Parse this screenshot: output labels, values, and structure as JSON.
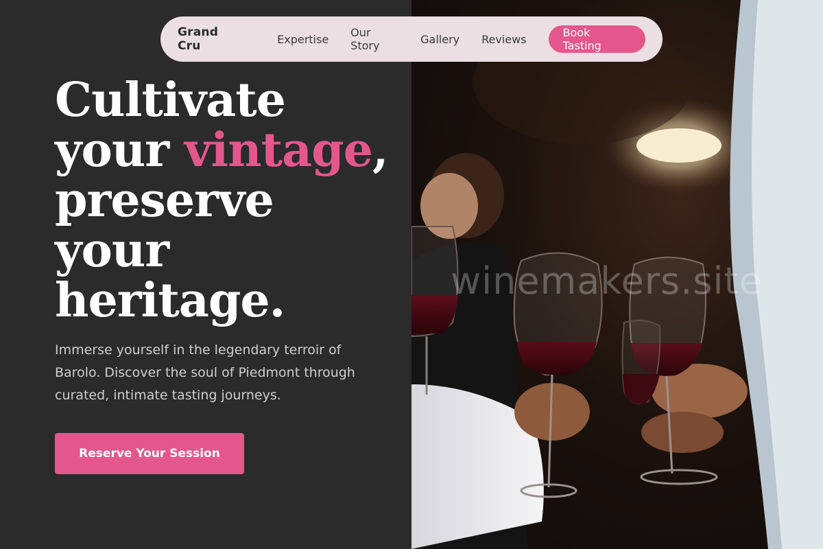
{
  "nav": {
    "brand": "Grand Cru",
    "links": [
      "Expertise",
      "Our Story",
      "Gallery",
      "Reviews"
    ],
    "cta": "Book Tasting"
  },
  "hero": {
    "headline_part1": "Cultivate your ",
    "headline_accent": "vintage",
    "headline_part2": ", preserve your heritage.",
    "subtext": "Immerse yourself in the legendary terroir of Barolo. Discover the soul of Piedmont through curated, intimate tasting journeys.",
    "cta": "Reserve Your Session"
  },
  "image": {
    "watermark": "winemakers.site",
    "description_icon": "wine-toast-photo"
  },
  "colors": {
    "accent": "#e4578a",
    "background": "#2b2b2c",
    "nav_bg": "#ecdfe4"
  }
}
